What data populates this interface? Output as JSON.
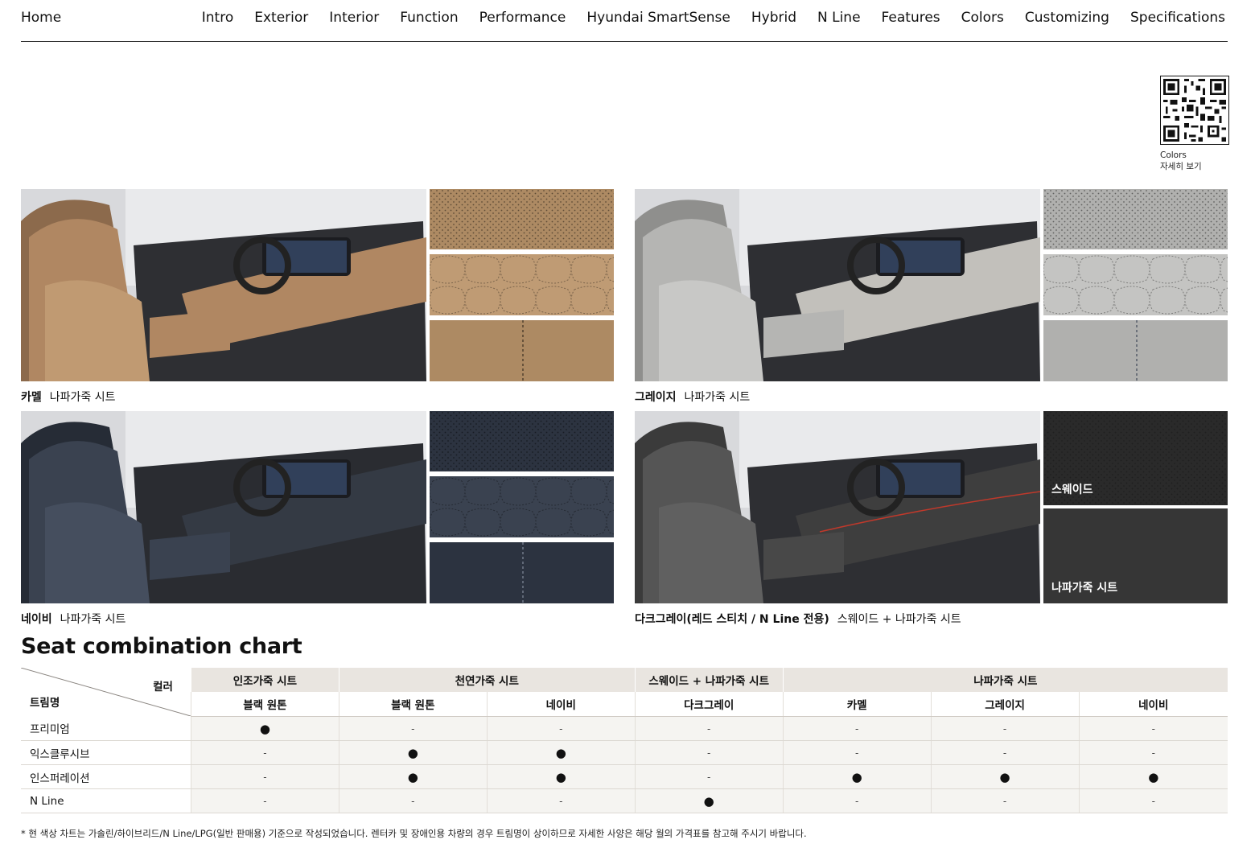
{
  "nav": {
    "home": "Home",
    "items": [
      "Intro",
      "Exterior",
      "Interior",
      "Function",
      "Performance",
      "Hyundai SmartSense",
      "Hybrid",
      "N Line",
      "Features",
      "Colors",
      "Customizing",
      "Specifications"
    ]
  },
  "qr": {
    "caption_line1": "Colors",
    "caption_line2": "자세히 보기"
  },
  "interiors": [
    {
      "color": "카멜",
      "material": "나파가죽 시트",
      "colors": {
        "seat": "#b08762",
        "seat_dark": "#8c6a4c",
        "dash": "#c09a72",
        "swatch": "#ad8a63",
        "swatch_hi": "#bf9b74"
      }
    },
    {
      "color": "그레이지",
      "material": "나파가죽 시트",
      "colors": {
        "seat": "#b5b5b3",
        "seat_dark": "#8f8f8d",
        "dash": "#c2c0bb",
        "swatch": "#b0b0ae",
        "swatch_hi": "#c4c4c2"
      }
    },
    {
      "color": "네이비",
      "material": "나파가죽 시트",
      "colors": {
        "seat": "#3a4250",
        "seat_dark": "#262c36",
        "dash": "#343a44",
        "swatch": "#2c3340",
        "swatch_hi": "#3a4250"
      }
    },
    {
      "color": "다크그레이(레드 스티치 / N Line 전용)",
      "material": "스웨이드 + 나파가죽 시트",
      "swatch_labels": [
        "스웨이드",
        "나파가죽 시트"
      ],
      "colors": {
        "seat": "#555555",
        "seat_dark": "#3b3b3b",
        "dash": "#3e3e3e",
        "swatch": "#2a2a2a",
        "swatch_hi": "#363636"
      }
    }
  ],
  "section_title": "Seat combination chart",
  "table": {
    "corner_color": "컬러",
    "corner_trim": "트림명",
    "groups": [
      "인조가죽 시트",
      "천연가죽 시트",
      "스웨이드 + 나파가죽 시트",
      "나파가죽 시트"
    ],
    "columns": [
      "블랙 원톤",
      "블랙 원톤",
      "네이비",
      "다크그레이",
      "카멜",
      "그레이지",
      "네이비"
    ],
    "rows": [
      {
        "trim": "프리미엄",
        "cells": [
          "●",
          "-",
          "-",
          "-",
          "-",
          "-",
          "-"
        ]
      },
      {
        "trim": "익스클루시브",
        "cells": [
          "-",
          "●",
          "●",
          "-",
          "-",
          "-",
          "-"
        ]
      },
      {
        "trim": "인스퍼레이션",
        "cells": [
          "-",
          "●",
          "●",
          "-",
          "●",
          "●",
          "●"
        ]
      },
      {
        "trim": "N Line",
        "cells": [
          "-",
          "-",
          "-",
          "●",
          "-",
          "-",
          "-"
        ]
      }
    ]
  },
  "footnote": "* 현 색상 차트는 가솔린/하이브리드/N Line/LPG(일반 판매용) 기준으로 작성되었습니다. 렌터카 및 장애인용 차량의 경우 트림명이 상이하므로 자세한 사양은 해당 월의 가격표를 참고해 주시기 바랍니다."
}
